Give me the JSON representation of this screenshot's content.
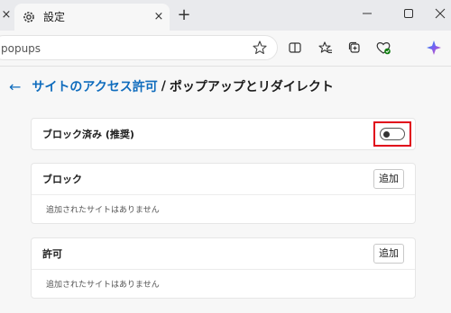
{
  "tab": {
    "title": "設定"
  },
  "address": {
    "url": "popups"
  },
  "page": {
    "breadcrumb_link": "サイトのアクセス許可",
    "separator": "/",
    "title": "ポップアップとリダイレクト"
  },
  "blocked_setting": {
    "label": "ブロック済み (推奨)",
    "enabled": false
  },
  "block_section": {
    "label": "ブロック",
    "add_button": "追加",
    "empty_text": "追加されたサイトはありません"
  },
  "allow_section": {
    "label": "許可",
    "add_button": "追加",
    "empty_text": "追加されたサイトはありません"
  },
  "icons": {
    "prev_tab_close": "×",
    "tab_close": "×",
    "new_tab": "+",
    "back": "←"
  },
  "colors": {
    "accent": "#0f6cbd",
    "highlight": "#e0001a"
  }
}
